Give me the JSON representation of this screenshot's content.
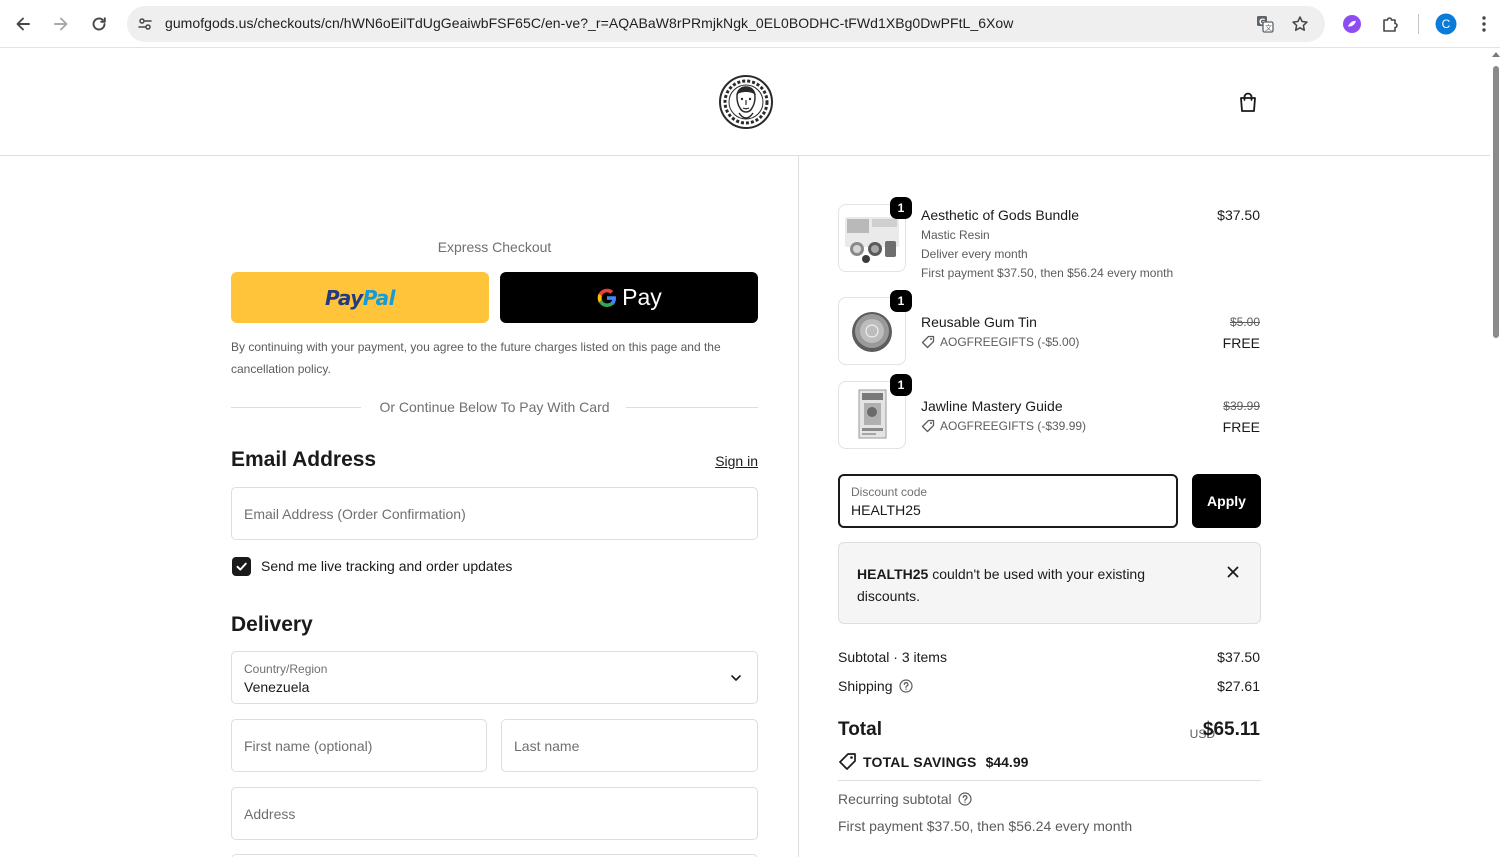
{
  "browser": {
    "url": "gumofgods.us/checkouts/cn/hWN6oEilTdUgGeaiwbFSF65C/en-ve?_r=AQABaW8rPRmjkNgk_0EL0BODHC-tFWd1XBg0DwPFtL_6Xow",
    "profile_initial": "C"
  },
  "express": {
    "title": "Express Checkout",
    "paypal_pay": "Pay",
    "paypal_pal": "Pal",
    "gpay_label": "Pay",
    "consent": "By continuing with your payment, you agree to the future charges listed on this page and the cancellation policy.",
    "divider_text": "Or Continue Below To Pay With Card"
  },
  "contact": {
    "heading": "Email Address",
    "signin": "Sign in",
    "email_placeholder": "Email Address (Order Confirmation)",
    "checkbox_label": "Send me live tracking and order updates",
    "checkbox_checked": true
  },
  "delivery": {
    "heading": "Delivery",
    "country_label": "Country/Region",
    "country_value": "Venezuela",
    "first_name_placeholder": "First name (optional)",
    "last_name_placeholder": "Last name",
    "address_placeholder": "Address"
  },
  "items": [
    {
      "quantity": "1",
      "title": "Aesthetic of Gods Bundle",
      "variant": "Mastic Resin",
      "frequency": "Deliver every month",
      "billing": "First payment $37.50, then $56.24 every month",
      "price": "$37.50"
    },
    {
      "quantity": "1",
      "title": "Reusable Gum Tin",
      "discount": "AOGFREEGIFTS (-$5.00)",
      "original_price": "$5.00",
      "price": "FREE"
    },
    {
      "quantity": "1",
      "title": "Jawline Mastery Guide",
      "discount": "AOGFREEGIFTS (-$39.99)",
      "original_price": "$39.99",
      "price": "FREE"
    }
  ],
  "discount": {
    "label": "Discount code",
    "value": "HEALTH25",
    "apply_label": "Apply",
    "error_code": "HEALTH25",
    "error_message": " couldn't be used with your existing discounts."
  },
  "summary": {
    "subtotal_label": "Subtotal · 3 items",
    "subtotal_value": "$37.50",
    "shipping_label": "Shipping",
    "shipping_value": "$27.61",
    "total_label": "Total",
    "total_currency": "USD",
    "total_value": "$65.11",
    "savings_label": "TOTAL SAVINGS",
    "savings_value": "$44.99",
    "recurring_label": "Recurring subtotal",
    "recurring_note": "First payment $37.50, then $56.24 every month"
  },
  "colors": {
    "paypal_yellow": "#ffc439",
    "paypal_dark_blue": "#253b80",
    "paypal_light_blue": "#179bd7",
    "primary_button": "#000000",
    "extension_purple": "#8f4cf2",
    "profile_blue": "#0b7bd8"
  },
  "icons": [
    "back-arrow-icon",
    "forward-arrow-icon",
    "reload-icon",
    "site-info-icon",
    "translate-icon",
    "bookmark-star-icon",
    "extension-icon",
    "puzzle-icon",
    "profile-avatar",
    "more-menu-icon",
    "brand-logo",
    "shopping-bag-icon",
    "checkmark-icon",
    "chevron-down-icon",
    "tag-icon",
    "close-icon",
    "help-circle-icon"
  ]
}
